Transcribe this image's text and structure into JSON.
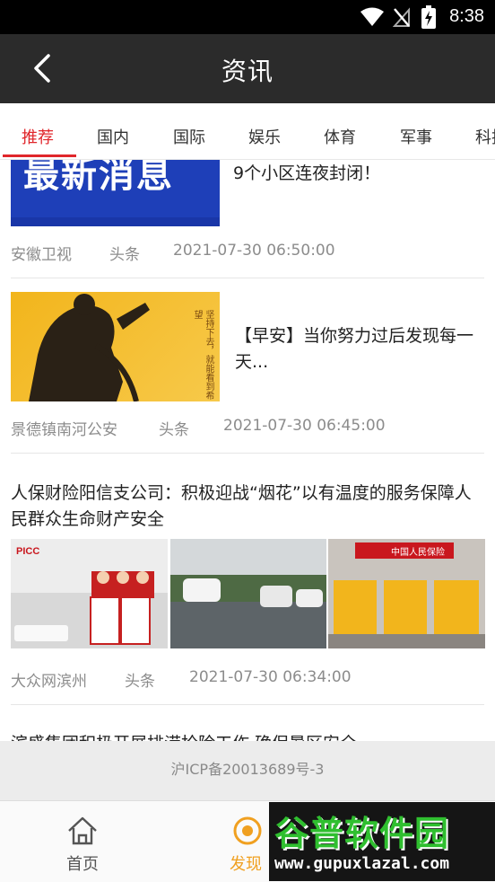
{
  "status_bar": {
    "time": "8:38"
  },
  "header": {
    "title": "资讯"
  },
  "tabs": [
    {
      "label": "推荐",
      "active": true
    },
    {
      "label": "国内"
    },
    {
      "label": "国际"
    },
    {
      "label": "娱乐"
    },
    {
      "label": "体育"
    },
    {
      "label": "军事"
    },
    {
      "label": "科技"
    }
  ],
  "articles": [
    {
      "title": "9个小区连夜封闭！",
      "thumb_text": "最新消息",
      "source": "安徽卫视",
      "category": "头条",
      "time": "2021-07-30 06:50:00"
    },
    {
      "title": "【早安】当你努力过后发现每一天...",
      "thumb_text": "坚持下去，就能看到希望",
      "source": "景德镇南河公安",
      "category": "头条",
      "time": "2021-07-30 06:45:00"
    },
    {
      "title": "人保财险阳信支公司：积极迎战“烟花”以有温度的服务保障人民群众生命财产安全",
      "thumb_texts": [
        "PICC",
        "中国人民保险"
      ],
      "source": "大众网滨州",
      "category": "头条",
      "time": "2021-07-30 06:34:00"
    },
    {
      "title": "滨盛集团积极开展排涝抢险工作 确保暑区安全"
    }
  ],
  "footer": {
    "icp": "沪ICP备20013689号-3"
  },
  "bottom_nav": [
    {
      "label": "首页",
      "icon": "home-icon"
    },
    {
      "label": "发现",
      "icon": "discover-icon",
      "active": true
    }
  ],
  "watermark": {
    "line1": "谷普软件园",
    "line2": "www.gupuxlazal.com"
  },
  "colors": {
    "accent": "#e0262b",
    "header_bg": "#2b2b2b",
    "active_nav": "#f0a020"
  }
}
